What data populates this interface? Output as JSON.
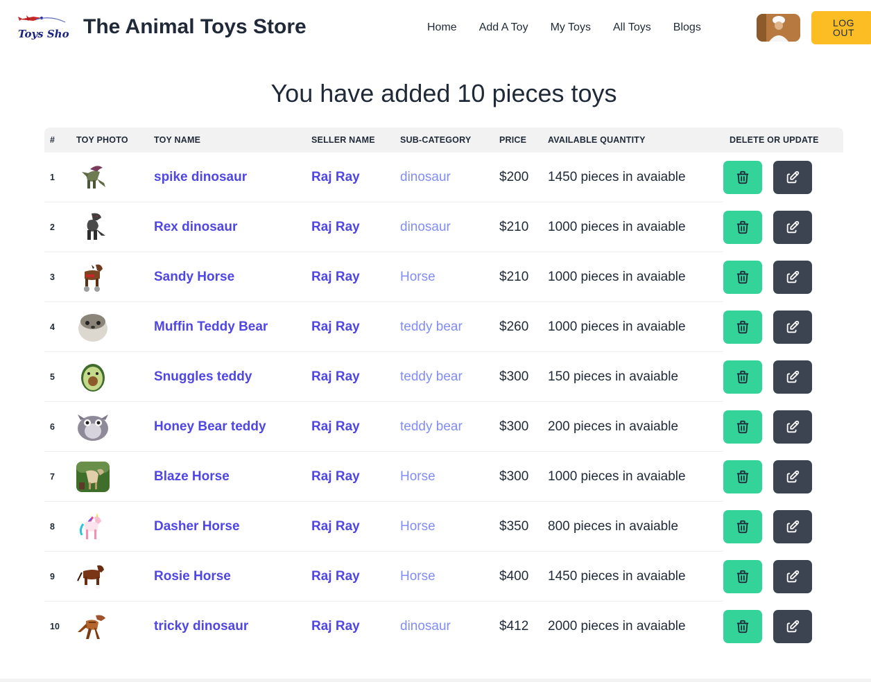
{
  "navbar": {
    "logo_text": "Toys Shop",
    "title": "The Animal Toys Store",
    "links": [
      "Home",
      "Add A Toy",
      "My Toys",
      "All Toys",
      "Blogs"
    ],
    "logout_label": "LOG\nOUT"
  },
  "heading": "You have added 10 pieces toys",
  "table": {
    "headers": [
      "#",
      "TOY PHOTO",
      "TOY NAME",
      "SELLER NAME",
      "SUB-CATEGORY",
      "PRICE",
      "AVAILABLE QUANTITY",
      "DELETE OR UPDATE"
    ],
    "rows": [
      {
        "num": "1",
        "photo": "dino-dilophosaurus",
        "name": "spike dinosaur",
        "seller": "Raj Ray",
        "sub": "dinosaur",
        "price": "$200",
        "qty": "1450 pieces in avaiable"
      },
      {
        "num": "2",
        "photo": "dino-trex",
        "name": "Rex dinosaur",
        "seller": "Raj Ray",
        "sub": "dinosaur",
        "price": "$210",
        "qty": "1000 pieces in avaiable"
      },
      {
        "num": "3",
        "photo": "horse-ride-on",
        "name": "Sandy Horse",
        "seller": "Raj Ray",
        "sub": "Horse",
        "price": "$210",
        "qty": "1000 pieces in avaiable"
      },
      {
        "num": "4",
        "photo": "plush-otter",
        "name": "Muffin Teddy Bear",
        "seller": "Raj Ray",
        "sub": "teddy bear",
        "price": "$260",
        "qty": "1000 pieces in avaiable"
      },
      {
        "num": "5",
        "photo": "plush-avocado",
        "name": "Snuggles teddy",
        "seller": "Raj Ray",
        "sub": "teddy bear",
        "price": "$300",
        "qty": "150 pieces in avaiable"
      },
      {
        "num": "6",
        "photo": "plush-owl",
        "name": "Honey Bear teddy",
        "seller": "Raj Ray",
        "sub": "teddy bear",
        "price": "$300",
        "qty": "200 pieces in avaiable"
      },
      {
        "num": "7",
        "photo": "horse-photo",
        "name": "Blaze Horse",
        "seller": "Raj Ray",
        "sub": "Horse",
        "price": "$300",
        "qty": "1000 pieces in avaiable"
      },
      {
        "num": "8",
        "photo": "unicorn-rainbow",
        "name": "Dasher Horse",
        "seller": "Raj Ray",
        "sub": "Horse",
        "price": "$350",
        "qty": "800 pieces in avaiable"
      },
      {
        "num": "9",
        "photo": "horse-clydesdale",
        "name": "Rosie Horse",
        "seller": "Raj Ray",
        "sub": "Horse",
        "price": "$400",
        "qty": "1450 pieces in avaiable"
      },
      {
        "num": "10",
        "photo": "dino-raptor",
        "name": "tricky dinosaur",
        "seller": "Raj Ray",
        "sub": "dinosaur",
        "price": "$412",
        "qty": "2000 pieces in avaiable"
      }
    ]
  },
  "icons": {
    "delete": "trash-icon",
    "update": "edit-icon"
  },
  "colors": {
    "link": "#4f46e5",
    "sub": "#818cf8",
    "delete_btn": "#34d399",
    "update_btn": "#3d4451",
    "logout_btn": "#fbbd23"
  }
}
